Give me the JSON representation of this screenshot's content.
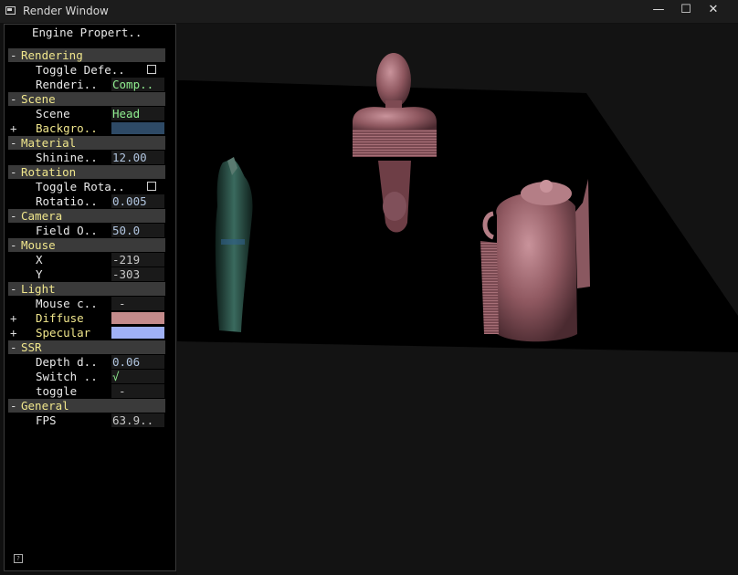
{
  "window": {
    "title": "Render Window",
    "minimize_glyph": "—",
    "maximize_glyph": "☐",
    "close_glyph": "✕"
  },
  "panel": {
    "title": "Engine Propert..",
    "rows": [
      {
        "kind": "group",
        "sym": "-",
        "label": "Rendering"
      },
      {
        "kind": "prop",
        "label": "Toggle Defe..",
        "checkbox": true
      },
      {
        "kind": "prop",
        "label": "Renderi..",
        "value": "Comp..",
        "value_style": "green"
      },
      {
        "kind": "group",
        "sym": "-",
        "label": "Scene"
      },
      {
        "kind": "prop",
        "label": "Scene",
        "value": "Head",
        "value_style": "green"
      },
      {
        "kind": "prop",
        "sym": "+",
        "label": "Backgro..",
        "label_style": "yellow",
        "swatch": "#2e4a66"
      },
      {
        "kind": "group",
        "sym": "-",
        "label": "Material"
      },
      {
        "kind": "prop",
        "label": "Shinine..",
        "value": "12.00"
      },
      {
        "kind": "group",
        "sym": "-",
        "label": "Rotation"
      },
      {
        "kind": "prop",
        "label": "Toggle Rota..",
        "checkbox": true
      },
      {
        "kind": "prop",
        "label": "Rotatio..",
        "value": "0.005"
      },
      {
        "kind": "group",
        "sym": "-",
        "label": "Camera"
      },
      {
        "kind": "prop",
        "label": "Field O..",
        "value": "50.0"
      },
      {
        "kind": "group",
        "sym": "-",
        "label": "Mouse"
      },
      {
        "kind": "prop",
        "label": "X",
        "value": "-219",
        "value_style": "gray"
      },
      {
        "kind": "prop",
        "label": "Y",
        "value": "-303",
        "value_style": "gray"
      },
      {
        "kind": "group",
        "sym": "-",
        "label": "Light"
      },
      {
        "kind": "prop",
        "label": "Mouse c..",
        "value": "-",
        "value_style": "gray center"
      },
      {
        "kind": "prop",
        "sym": "+",
        "label": "Diffuse",
        "label_style": "yellow",
        "swatch": "#c48b8b"
      },
      {
        "kind": "prop",
        "sym": "+",
        "label": "Specular",
        "label_style": "yellow",
        "swatch": "#9fb0f5"
      },
      {
        "kind": "group",
        "sym": "-",
        "label": "SSR"
      },
      {
        "kind": "prop",
        "label": "Depth d..",
        "value": "0.06"
      },
      {
        "kind": "prop",
        "label": "Switch ..",
        "value": "√",
        "value_style": "green"
      },
      {
        "kind": "prop",
        "label": "toggle",
        "value": "-",
        "value_style": "gray center"
      },
      {
        "kind": "group",
        "sym": "-",
        "label": "General"
      },
      {
        "kind": "prop",
        "label": "FPS",
        "value": "63.9..",
        "value_style": "gray"
      }
    ],
    "help_glyph": "?"
  },
  "scene_colors": {
    "floor": "#000000",
    "skin": "#9a6068",
    "statue": "#1f3a33"
  }
}
